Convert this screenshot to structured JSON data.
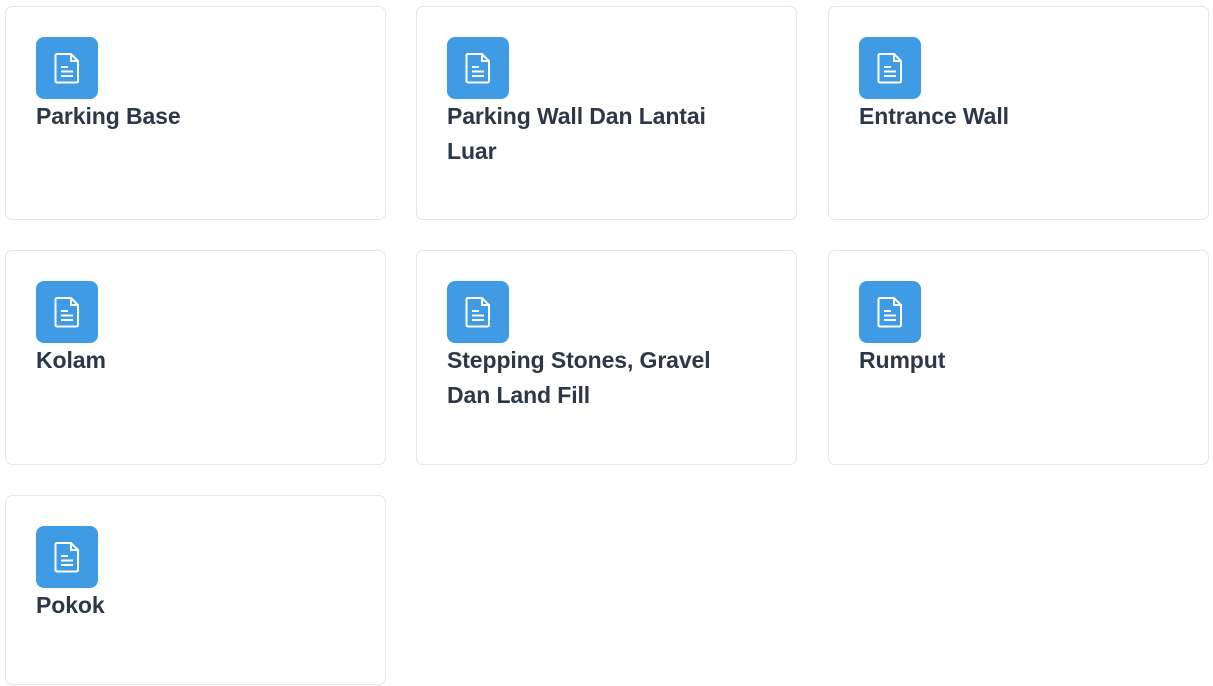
{
  "accent_color": "#3f9be3",
  "text_color": "#2d3748",
  "cards": [
    {
      "title": "Parking Base",
      "icon": "document-icon"
    },
    {
      "title": "Parking Wall Dan Lantai Luar",
      "icon": "document-icon"
    },
    {
      "title": "Entrance Wall",
      "icon": "document-icon"
    },
    {
      "title": "Kolam",
      "icon": "document-icon"
    },
    {
      "title": "Stepping Stones, Gravel Dan Land Fill",
      "icon": "document-icon"
    },
    {
      "title": "Rumput",
      "icon": "document-icon"
    },
    {
      "title": "Pokok",
      "icon": "document-icon"
    }
  ]
}
